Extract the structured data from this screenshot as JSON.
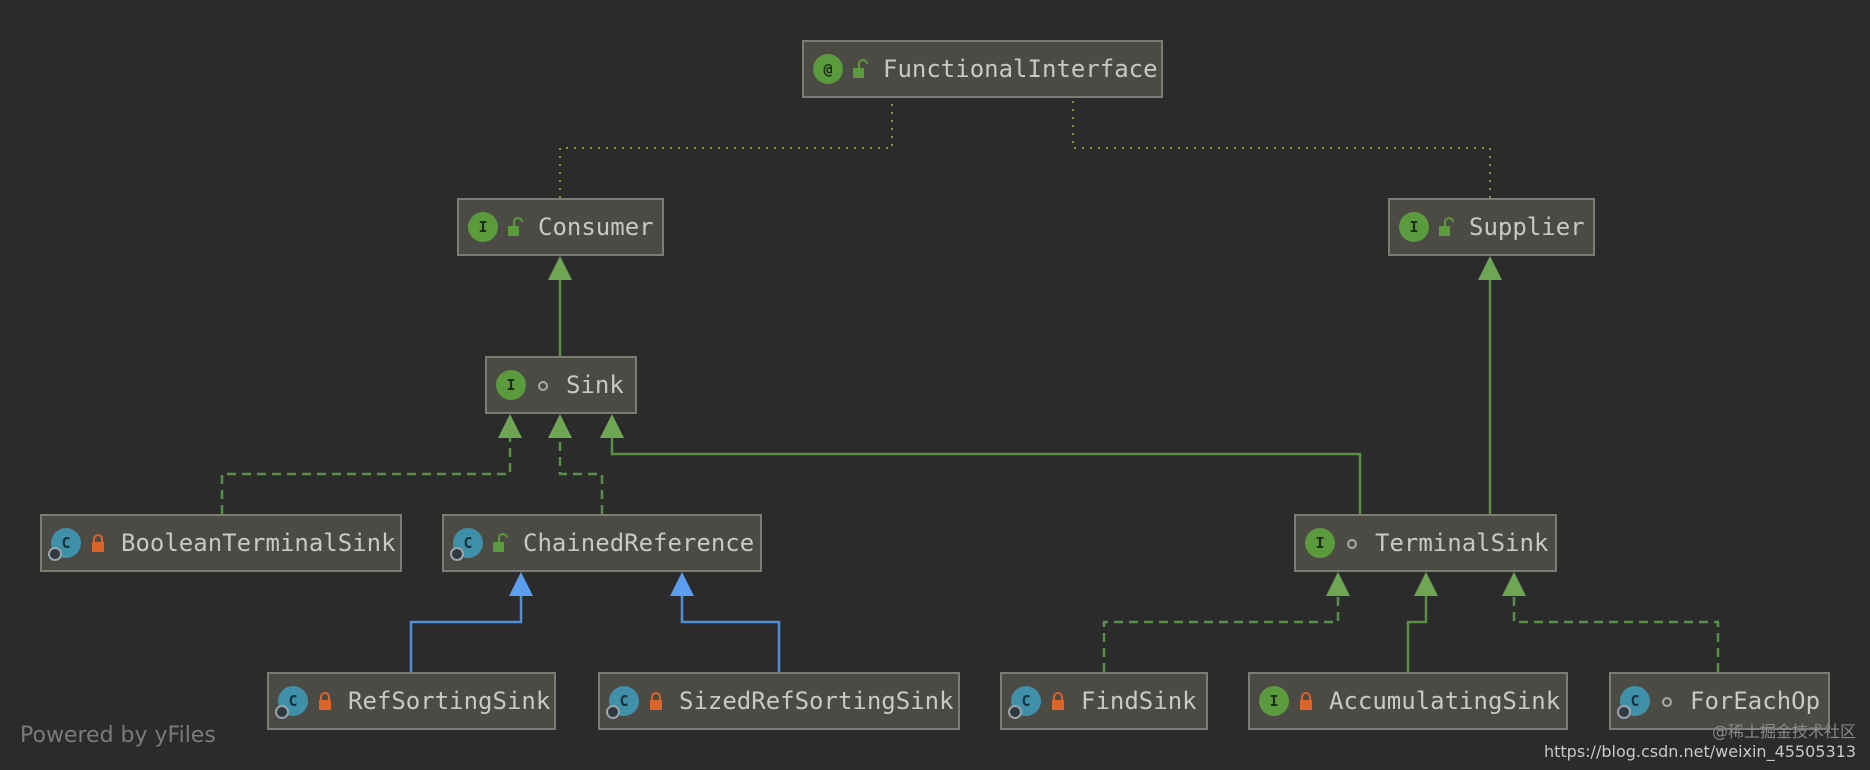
{
  "nodes": {
    "functional_interface": {
      "label": "FunctionalInterface",
      "type_glyph": "@",
      "kind": "annotation",
      "visibility": "public"
    },
    "consumer": {
      "label": "Consumer",
      "type_glyph": "I",
      "kind": "interface",
      "visibility": "public"
    },
    "supplier": {
      "label": "Supplier",
      "type_glyph": "I",
      "kind": "interface",
      "visibility": "public"
    },
    "sink": {
      "label": "Sink",
      "type_glyph": "I",
      "kind": "interface",
      "visibility": "package"
    },
    "boolean_terminal_sink": {
      "label": "BooleanTerminalSink",
      "type_glyph": "C",
      "kind": "class",
      "visibility": "private"
    },
    "chained_reference": {
      "label": "ChainedReference",
      "type_glyph": "C",
      "kind": "class",
      "visibility": "public"
    },
    "terminal_sink": {
      "label": "TerminalSink",
      "type_glyph": "I",
      "kind": "interface",
      "visibility": "package"
    },
    "ref_sorting_sink": {
      "label": "RefSortingSink",
      "type_glyph": "C",
      "kind": "class",
      "visibility": "private"
    },
    "sized_ref_sorting_sink": {
      "label": "SizedRefSortingSink",
      "type_glyph": "C",
      "kind": "class",
      "visibility": "private"
    },
    "find_sink": {
      "label": "FindSink",
      "type_glyph": "C",
      "kind": "class",
      "visibility": "private"
    },
    "accumulating_sink": {
      "label": "AccumulatingSink",
      "type_glyph": "I",
      "kind": "interface",
      "visibility": "private"
    },
    "for_each_op": {
      "label": "ForEachOp",
      "type_glyph": "C",
      "kind": "class",
      "visibility": "package"
    }
  },
  "edges": [
    {
      "from": "consumer",
      "to": "functional_interface",
      "style": "annotation"
    },
    {
      "from": "supplier",
      "to": "functional_interface",
      "style": "annotation"
    },
    {
      "from": "sink",
      "to": "consumer",
      "style": "extends"
    },
    {
      "from": "terminal_sink",
      "to": "supplier",
      "style": "extends"
    },
    {
      "from": "terminal_sink",
      "to": "sink",
      "style": "extends"
    },
    {
      "from": "boolean_terminal_sink",
      "to": "sink",
      "style": "implements"
    },
    {
      "from": "chained_reference",
      "to": "sink",
      "style": "implements"
    },
    {
      "from": "ref_sorting_sink",
      "to": "chained_reference",
      "style": "class-extends"
    },
    {
      "from": "sized_ref_sorting_sink",
      "to": "chained_reference",
      "style": "class-extends"
    },
    {
      "from": "find_sink",
      "to": "terminal_sink",
      "style": "implements"
    },
    {
      "from": "accumulating_sink",
      "to": "terminal_sink",
      "style": "extends"
    },
    {
      "from": "for_each_op",
      "to": "terminal_sink",
      "style": "implements"
    }
  ],
  "colors": {
    "background": "#2b2b2b",
    "node_fill": "#4b4a45",
    "node_border": "#7c7b74",
    "interface_green": "#5b9a3d",
    "class_teal": "#3f90a8",
    "lock_orange": "#d9652a",
    "edge_green": "#5a8f47",
    "edge_blue": "#4f8fd9",
    "annotation_olive": "#8a8a3a"
  },
  "footer": {
    "powered_by": "Powered by yFiles"
  },
  "watermark": {
    "line1": "@稀土掘金技术社区",
    "line2": "https://blog.csdn.net/weixin_45505313"
  }
}
